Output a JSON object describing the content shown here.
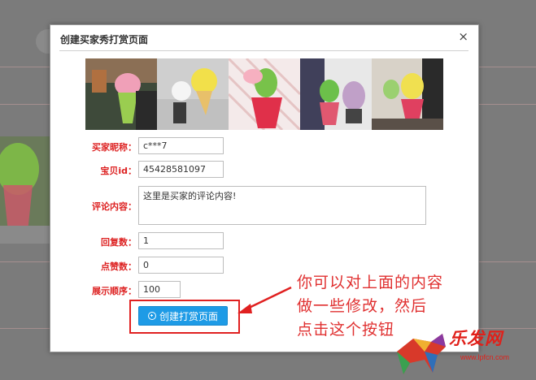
{
  "modal": {
    "title": "创建买家秀打赏页面",
    "close": "×"
  },
  "form": {
    "nickname_label": "买家昵称：",
    "nickname_value": "c***7",
    "item_id_label": "宝贝id：",
    "item_id_value": "45428581097",
    "comment_label": "评论内容：",
    "comment_value": "这里是买家的评论内容!",
    "replies_label": "回复数：",
    "replies_value": "1",
    "likes_label": "点赞数：",
    "likes_value": "0",
    "order_label": "展示顺序：",
    "order_value": "100"
  },
  "button": {
    "create_label": "创建打赏页面"
  },
  "annotation": {
    "line1": "你可以对上面的内容",
    "line2": "做一些修改，然后",
    "line3": "点击这个按钮"
  },
  "watermark": {
    "brand": "乐发网",
    "url": "www.lpfcn.com"
  },
  "colors": {
    "label_red": "#dd2222",
    "button_blue": "#1e9be6",
    "annotation_red": "#e03030"
  },
  "icons": [
    "close-icon",
    "plus-circle-icon",
    "arrow-icon"
  ]
}
